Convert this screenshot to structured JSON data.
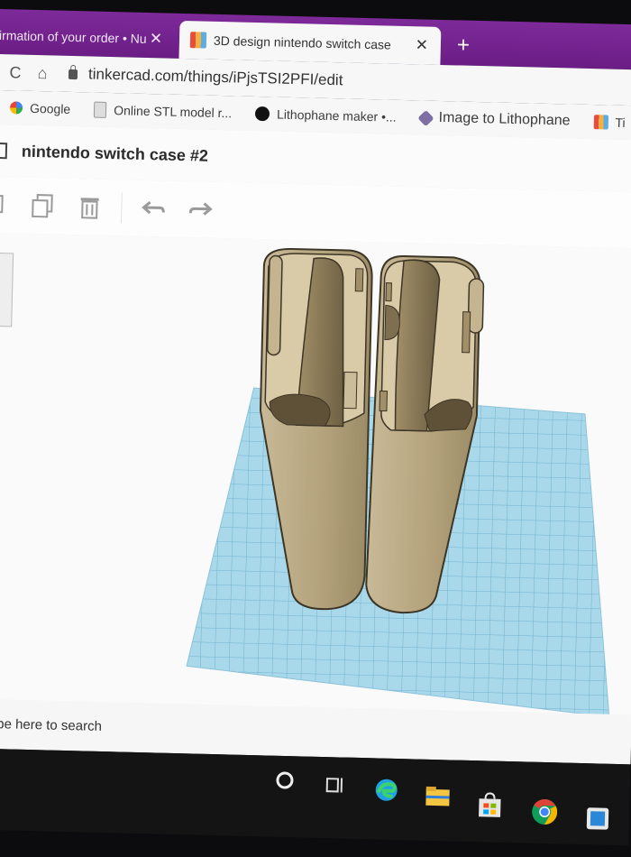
{
  "browser": {
    "tabs": [
      {
        "title": "irmation of your order • Nu",
        "active": false
      },
      {
        "title": "3D design nintendo switch case",
        "active": true
      }
    ],
    "new_tab_symbol": "+",
    "close_symbol": "✕",
    "url": "tinkercad.com/things/iPjsTSI2PFI/edit",
    "bookmarks": [
      {
        "label": "Google",
        "icon": "google-icon"
      },
      {
        "label": "Online STL model r...",
        "icon": "bookmark-page-icon"
      },
      {
        "label": "Lithophane maker •...",
        "icon": "lithophane-icon"
      },
      {
        "label": "Image to Lithophane",
        "icon": "cube-icon"
      },
      {
        "label": "Ti",
        "icon": "tinkercad-icon"
      }
    ]
  },
  "app": {
    "document_title": "nintendo switch case #2",
    "toolbar": [
      "copy-icon",
      "duplicate-icon",
      "trash-icon",
      "undo-icon",
      "redo-icon"
    ]
  },
  "taskbar": {
    "search_placeholder": "Type here to search",
    "icons": [
      "cortana-icon",
      "task-view-icon",
      "edge-icon",
      "file-explorer-icon",
      "store-icon",
      "chrome-icon"
    ]
  },
  "colors": {
    "tab_strip": "#7e2a9a",
    "workplane_grid": "#a9d8ea",
    "model": "#b8a882"
  }
}
